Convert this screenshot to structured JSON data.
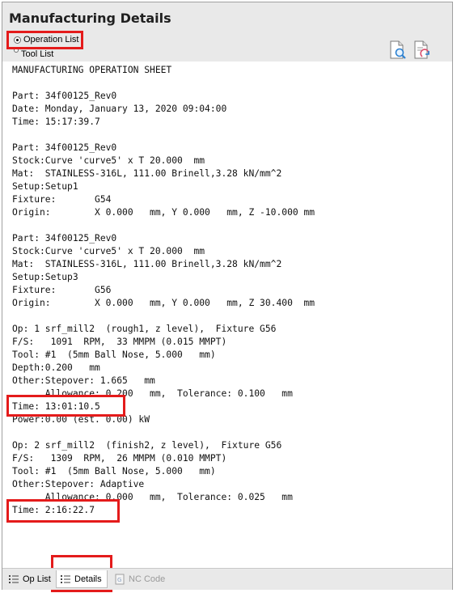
{
  "window": {
    "title": "Manufacturing Details"
  },
  "view_options": {
    "operation_list": "Operation List",
    "tool_list": "Tool List",
    "selected": "operation_list"
  },
  "toolbar": {
    "icons": [
      "document-search-icon",
      "document-refresh-icon"
    ]
  },
  "report": {
    "lines": [
      "MANUFACTURING OPERATION SHEET",
      "",
      "Part: 34f00125_Rev0",
      "Date: Monday, January 13, 2020 09:04:00",
      "Time: 15:17:39.7",
      "",
      "Part: 34f00125_Rev0",
      "Stock:Curve 'curve5' x T 20.000  mm",
      "Mat:  STAINLESS-316L, 111.00 Brinell,3.28 kN/mm^2",
      "Setup:Setup1",
      "Fixture:       G54",
      "Origin:        X 0.000   mm, Y 0.000   mm, Z -10.000 mm",
      "",
      "Part: 34f00125_Rev0",
      "Stock:Curve 'curve5' x T 20.000  mm",
      "Mat:  STAINLESS-316L, 111.00 Brinell,3.28 kN/mm^2",
      "Setup:Setup3",
      "Fixture:       G56",
      "Origin:        X 0.000   mm, Y 0.000   mm, Z 30.400  mm",
      "",
      "Op: 1 srf_mill2  (rough1, z level),  Fixture G56",
      "F/S:   1091  RPM,  33 MMPM (0.015 MMPT)",
      "Tool: #1  (5mm Ball Nose, 5.000   mm)",
      "Depth:0.200   mm",
      "Other:Stepover: 1.665   mm",
      "      Allowance: 0.200   mm,  Tolerance: 0.100   mm",
      "Time: 13:01:10.5",
      "Power:0.00 (est. 0.00) kW",
      "",
      "Op: 2 srf_mill2  (finish2, z level),  Fixture G56",
      "F/S:   1309  RPM,  26 MMPM (0.010 MMPT)",
      "Tool: #1  (5mm Ball Nose, 5.000   mm)",
      "Other:Stepover: Adaptive",
      "      Allowance: 0.000   mm,  Tolerance: 0.025   mm",
      "Time: 2:16:22.7"
    ]
  },
  "tabs": [
    {
      "label": "Op List",
      "state": "normal"
    },
    {
      "label": "Details",
      "state": "active"
    },
    {
      "label": "NC Code",
      "state": "disabled"
    }
  ],
  "colors": {
    "highlight": "#e41b1b",
    "header_bg": "#e9e9e9"
  }
}
